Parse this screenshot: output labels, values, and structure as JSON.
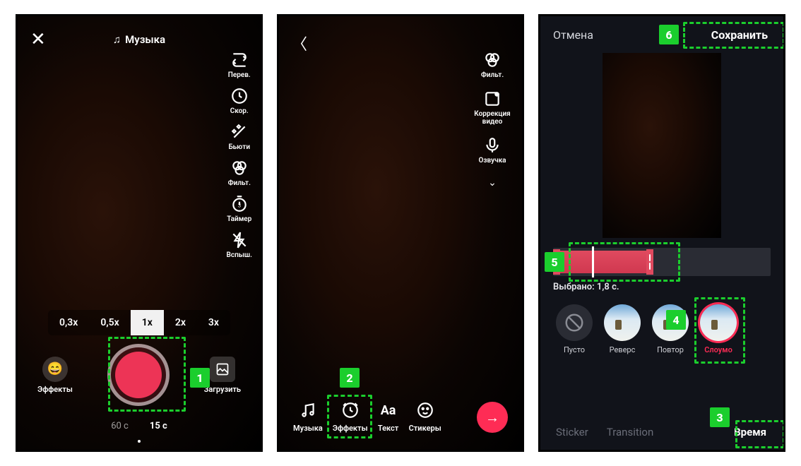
{
  "annotations": {
    "1": "1",
    "2": "2",
    "3": "3",
    "4": "4",
    "5": "5",
    "6": "6"
  },
  "screen1": {
    "music_label": "Музыка",
    "tools": {
      "flip": "Перев.",
      "speed": "Скор.",
      "beauty": "Бьюти",
      "filter": "Фильт.",
      "timer": "Таймер",
      "flash": "Вспыш."
    },
    "speeds": [
      "0,3x",
      "0,5x",
      "1x",
      "2x",
      "3x"
    ],
    "speed_active_index": 2,
    "effects_label": "Эффекты",
    "upload_label": "Загрузить",
    "durations": [
      "60 с",
      "15 с"
    ],
    "duration_active_index": 1
  },
  "screen2": {
    "tools": {
      "filter": "Фильт.",
      "video_correction": "Коррекция видео",
      "voiceover": "Озвучка"
    },
    "bottom": {
      "music": "Музыка",
      "effects": "Эффекты",
      "text": "Текст",
      "stickers": "Стикеры"
    }
  },
  "screen3": {
    "cancel": "Отмена",
    "save": "Сохранить",
    "selected_label": "Выбрано: 1,8 с.",
    "effects": {
      "none": "Пусто",
      "reverse": "Реверс",
      "repeat": "Повтор",
      "slowmo": "Слоумо"
    },
    "tabs": {
      "sticker": "Sticker",
      "transition": "Transition",
      "time": "Время"
    }
  }
}
